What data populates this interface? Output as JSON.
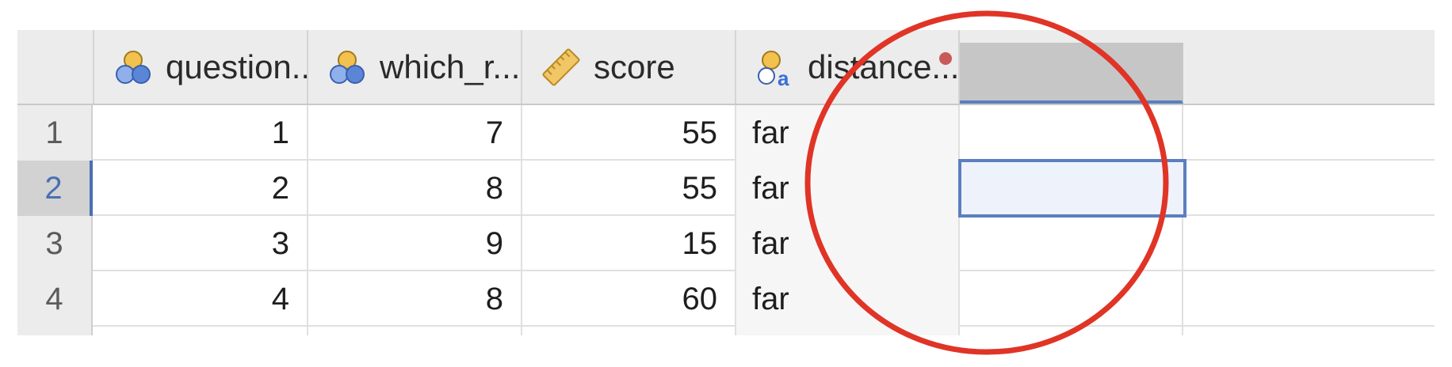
{
  "columns": [
    {
      "name": "question...",
      "type_icon": "nominal-icon",
      "align": "right"
    },
    {
      "name": "which_r...",
      "type_icon": "nominal-icon",
      "align": "right"
    },
    {
      "name": "score",
      "type_icon": "scale-ruler-icon",
      "align": "right"
    },
    {
      "name": "distance...",
      "type_icon": "nominal-text-icon",
      "align": "left",
      "modified": true
    },
    {
      "name": "",
      "type_icon": "",
      "align": "left"
    }
  ],
  "rows": [
    {
      "row_number": "1",
      "cells": [
        "1",
        "7",
        "55",
        "far",
        ""
      ]
    },
    {
      "row_number": "2",
      "cells": [
        "2",
        "8",
        "55",
        "far",
        ""
      ]
    },
    {
      "row_number": "3",
      "cells": [
        "3",
        "9",
        "15",
        "far",
        ""
      ]
    },
    {
      "row_number": "4",
      "cells": [
        "4",
        "8",
        "60",
        "far",
        ""
      ]
    }
  ],
  "selection": {
    "row": 2,
    "column": 5
  },
  "colors": {
    "selection_accent": "#5b7fbf",
    "modified_dot": "#c95a5a",
    "annotation_circle": "#e03426",
    "nominal_icon_top": "#f2c14e",
    "nominal_icon_bottom": "#5b86d8",
    "scale_icon": "#e9b54a"
  }
}
